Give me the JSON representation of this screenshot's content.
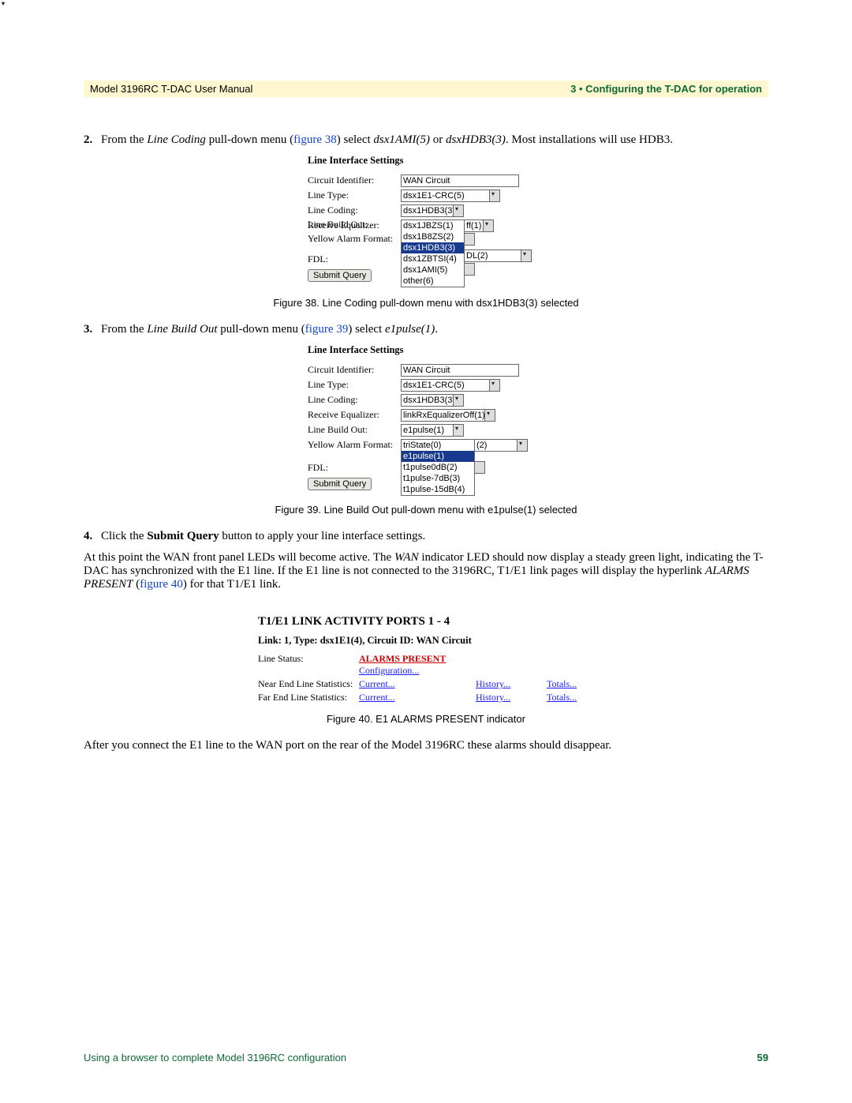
{
  "header": {
    "left": "Model 3196RC T-DAC User Manual",
    "right": "3 • Configuring the T-DAC for operation"
  },
  "steps": {
    "s2": {
      "num": "2.",
      "pre": "From the ",
      "em1": "Line Coding",
      "mid1": " pull-down menu (",
      "link": "figure 38",
      "mid2": ") select ",
      "em2": "dsx1AMI(5)",
      "mid3": " or ",
      "em3": "dsxHDB3(3)",
      "tail": ". Most installations will use HDB3."
    },
    "s3": {
      "num": "3.",
      "pre": "From the ",
      "em1": "Line Build Out",
      "mid1": " pull-down menu (",
      "link": "figure 39",
      "mid2": ") select ",
      "em2": "e1pulse(1)",
      "tail": "."
    },
    "s4": {
      "num": "4.",
      "pre": "Click the ",
      "bold": "Submit Query",
      "tail": " button to apply your line interface settings."
    }
  },
  "fig38": {
    "title": "Line Interface Settings",
    "circuit_lab": "Circuit Identifier:",
    "circuit_val": "WAN Circuit",
    "linetype_lab": "Line Type:",
    "linetype_val": "dsx1E1-CRC(5)",
    "linecoding_lab": "Line Coding:",
    "linecoding_val": "dsx1HDB3(3)",
    "receq_lab": "Receive Equalizer:",
    "receq_tail": "ff(1)",
    "lbo_lab": "Line Build Out:",
    "yaf_lab": "Yellow Alarm Format:",
    "yaf_tail": "DL(2)",
    "fdl_lab": "FDL:",
    "submit": "Submit Query",
    "options": [
      "dsx1JBZS(1)",
      "dsx1B8ZS(2)",
      "dsx1HDB3(3)",
      "dsx1ZBTSI(4)",
      "dsx1AMI(5)",
      "other(6)"
    ],
    "caption": "Figure 38. Line Coding pull-down menu with dsx1HDB3(3) selected"
  },
  "fig39": {
    "title": "Line Interface Settings",
    "circuit_lab": "Circuit Identifier:",
    "circuit_val": "WAN Circuit",
    "linetype_lab": "Line Type:",
    "linetype_val": "dsx1E1-CRC(5)",
    "linecoding_lab": "Line Coding:",
    "linecoding_val": "dsx1HDB3(3)",
    "receq_lab": "Receive Equalizer:",
    "receq_val": "linkRxEqualizerOff(1)",
    "lbo_lab": "Line Build Out:",
    "lbo_val": "e1pulse(1)",
    "yaf_lab": "Yellow Alarm Format:",
    "yaf_tail": "(2)",
    "fdl_lab": "FDL:",
    "submit": "Submit Query",
    "options": [
      "triState(0)",
      "e1pulse(1)",
      "t1pulse0dB(2)",
      "t1pulse-7dB(3)",
      "t1pulse-15dB(4)"
    ],
    "caption": "Figure 39. Line Build Out pull-down menu with e1pulse(1) selected"
  },
  "body": {
    "p1a": "At this point the WAN front panel LEDs will become active. The ",
    "p1em": "WAN",
    "p1b": " indicator LED should now display a steady green light, indicating the T-DAC has synchronized with the E1 line. If the E1 line is not connected to the 3196RC, T1/E1 link pages will display the hyperlink ",
    "p1em2": "ALARMS PRESENT",
    "p1c": " (",
    "p1link": "figure 40",
    "p1d": ") for that T1/E1 link.",
    "p2": "After you connect the E1 line to the WAN port on the rear of the Model 3196RC these alarms should disappear."
  },
  "fig40": {
    "heading": "T1/E1 LINK ACTIVITY PORTS 1 - 4",
    "sub": "Link: 1, Type: dsx1E1(4), Circuit ID: WAN Circuit",
    "row1_lab": "Line Status:",
    "row1_alarm": "ALARMS PRESENT",
    "row1_conf": "Configuration...",
    "row2_lab": "Near End Line Statistics:",
    "row2_cur": "Current...",
    "row2_hist": "History...",
    "row2_tot": "Totals...",
    "row3_lab": "Far End Line Statistics:",
    "row3_cur": "Current...",
    "row3_hist": "History...",
    "row3_tot": "Totals...",
    "caption": "Figure 40. E1 ALARMS PRESENT indicator"
  },
  "footer": {
    "left": "Using a browser to complete Model 3196RC configuration",
    "page": "59"
  }
}
